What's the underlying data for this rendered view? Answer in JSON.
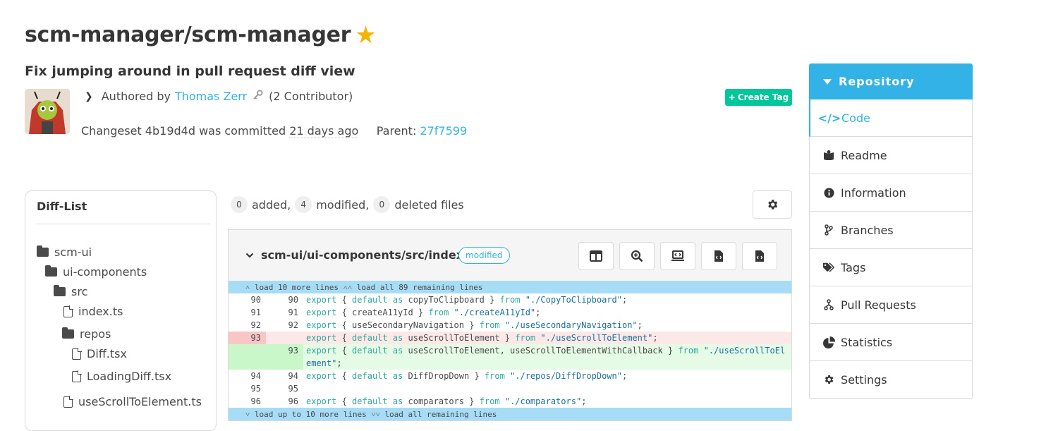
{
  "repo": {
    "title": "scm-manager/scm-manager",
    "star_icon": "star-icon"
  },
  "changeset": {
    "title": "Fix jumping around in pull request diff view",
    "authored_prefix": "Authored by",
    "author": "Thomas Zerr",
    "contributors": "(2 Contributor)",
    "commit_prefix": "Changeset 4b19d4d was committed",
    "commit_age": "21 days ago",
    "parent_label": "Parent:",
    "parent_id": "27f7599",
    "create_tag": "Create Tag"
  },
  "diff_list": {
    "title": "Diff-List",
    "tree": [
      {
        "label": "scm-ui",
        "type": "folder"
      },
      {
        "label": "ui-components",
        "type": "folder"
      },
      {
        "label": "src",
        "type": "folder"
      },
      {
        "label": "index.ts",
        "type": "file"
      },
      {
        "label": "repos",
        "type": "folder"
      },
      {
        "label": "Diff.tsx",
        "type": "file"
      },
      {
        "label": "LoadingDiff.tsx",
        "type": "file"
      },
      {
        "label": "useScrollToElement.ts",
        "type": "file"
      }
    ]
  },
  "summary": {
    "added_count": "0",
    "added_label": "added,",
    "modified_count": "4",
    "modified_label": "modified,",
    "deleted_count": "0",
    "deleted_label": "deleted files"
  },
  "diff": {
    "file_path": "scm-ui/ui-components/src/index.ts",
    "status": "modified",
    "top_expander": "load 10 more lines",
    "top_expander_all": "load all 89 remaining lines",
    "bottom_expander": "load up to 10 more lines",
    "bottom_expander_all": "load all remaining lines",
    "lines": [
      {
        "old": "90",
        "new": "90",
        "type": "normal",
        "parts": [
          [
            "kw",
            "export"
          ],
          [
            "p",
            " { "
          ],
          [
            "kw",
            "default as"
          ],
          [
            "p",
            " copyToClipboard } "
          ],
          [
            "kw",
            "from"
          ],
          [
            "p",
            " "
          ],
          [
            "str",
            "\"./CopyToClipboard\""
          ],
          [
            "p",
            ";"
          ]
        ]
      },
      {
        "old": "91",
        "new": "91",
        "type": "normal",
        "parts": [
          [
            "kw",
            "export"
          ],
          [
            "p",
            " { createA11yId } "
          ],
          [
            "kw",
            "from"
          ],
          [
            "p",
            " "
          ],
          [
            "str",
            "\"./createA11yId\""
          ],
          [
            "p",
            ";"
          ]
        ]
      },
      {
        "old": "92",
        "new": "92",
        "type": "normal",
        "parts": [
          [
            "kw",
            "export"
          ],
          [
            "p",
            " { useSecondaryNavigation } "
          ],
          [
            "kw",
            "from"
          ],
          [
            "p",
            " "
          ],
          [
            "str",
            "\"./useSecondaryNavigation\""
          ],
          [
            "p",
            ";"
          ]
        ]
      },
      {
        "old": "93",
        "new": "",
        "type": "delete",
        "parts": [
          [
            "kw",
            "export"
          ],
          [
            "p",
            " { "
          ],
          [
            "kw",
            "default as"
          ],
          [
            "p",
            " useScrollToElement } "
          ],
          [
            "kw",
            "from"
          ],
          [
            "p",
            " "
          ],
          [
            "str",
            "\"./useScrollToElement\""
          ],
          [
            "p",
            ";"
          ]
        ]
      },
      {
        "old": "",
        "new": "93",
        "type": "insert",
        "parts": [
          [
            "kw",
            "export"
          ],
          [
            "p",
            " { "
          ],
          [
            "kw",
            "default as"
          ],
          [
            "p",
            " useScrollToElement, useScrollToElementWithCallback } "
          ],
          [
            "kw",
            "from"
          ],
          [
            "p",
            " "
          ],
          [
            "str",
            "\"./useScrollToElement\""
          ],
          [
            "p",
            ";"
          ]
        ]
      },
      {
        "old": "94",
        "new": "94",
        "type": "normal",
        "parts": [
          [
            "kw",
            "export"
          ],
          [
            "p",
            " { "
          ],
          [
            "kw",
            "default as"
          ],
          [
            "p",
            " DiffDropDown } "
          ],
          [
            "kw",
            "from"
          ],
          [
            "p",
            " "
          ],
          [
            "str",
            "\"./repos/DiffDropDown\""
          ],
          [
            "p",
            ";"
          ]
        ]
      },
      {
        "old": "95",
        "new": "95",
        "type": "normal",
        "parts": []
      },
      {
        "old": "96",
        "new": "96",
        "type": "normal",
        "parts": [
          [
            "kw",
            "export"
          ],
          [
            "p",
            " { "
          ],
          [
            "kw",
            "default as"
          ],
          [
            "p",
            " comparators } "
          ],
          [
            "kw",
            "from"
          ],
          [
            "p",
            " "
          ],
          [
            "str",
            "\"./comparators\""
          ],
          [
            "p",
            ";"
          ]
        ]
      }
    ]
  },
  "sidebar": {
    "header": "Repository",
    "items": [
      {
        "label": "Code",
        "icon": "code-icon"
      },
      {
        "label": "Readme",
        "icon": "book-icon"
      },
      {
        "label": "Information",
        "icon": "info-icon"
      },
      {
        "label": "Branches",
        "icon": "branch-icon"
      },
      {
        "label": "Tags",
        "icon": "tags-icon"
      },
      {
        "label": "Pull Requests",
        "icon": "pull-request-icon"
      },
      {
        "label": "Statistics",
        "icon": "chart-pie-icon"
      },
      {
        "label": "Settings",
        "icon": "gear-icon"
      }
    ]
  },
  "colors": {
    "accent": "#33b2e8",
    "create_tag": "#00c79b",
    "delete_bg": "#fde8e8",
    "insert_bg": "#e6fbe6",
    "expander": "#a6dcf5"
  }
}
